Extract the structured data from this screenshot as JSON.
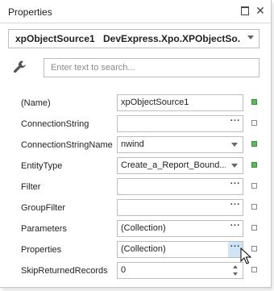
{
  "window": {
    "title": "Properties"
  },
  "selector": {
    "object_name": "xpObjectSource1",
    "object_type": "DevExpress.Xpo.XPObjectSo..."
  },
  "search": {
    "placeholder": "Enter text to search..."
  },
  "colors": {
    "marker_set": "#5cb85c",
    "hover_button": "#cfe4f7"
  },
  "properties": [
    {
      "name": "(Name)",
      "value": "xpObjectSource1",
      "editor": "text",
      "value_set": true
    },
    {
      "name": "ConnectionString",
      "value": "",
      "editor": "ellipsis",
      "value_set": false
    },
    {
      "name": "ConnectionStringName",
      "value": "nwind",
      "editor": "dropdown",
      "value_set": true
    },
    {
      "name": "EntityType",
      "value": "Create_a_Report_Bound...",
      "editor": "dropdown",
      "value_set": true
    },
    {
      "name": "Filter",
      "value": "",
      "editor": "ellipsis",
      "value_set": false
    },
    {
      "name": "GroupFilter",
      "value": "",
      "editor": "ellipsis",
      "value_set": false
    },
    {
      "name": "Parameters",
      "value": "(Collection)",
      "editor": "ellipsis",
      "value_set": false
    },
    {
      "name": "Properties",
      "value": "(Collection)",
      "editor": "ellipsis",
      "value_set": false,
      "hover": true
    },
    {
      "name": "SkipReturnedRecords",
      "value": "0",
      "editor": "spin",
      "value_set": false
    }
  ],
  "ellipsis_glyph": "···"
}
